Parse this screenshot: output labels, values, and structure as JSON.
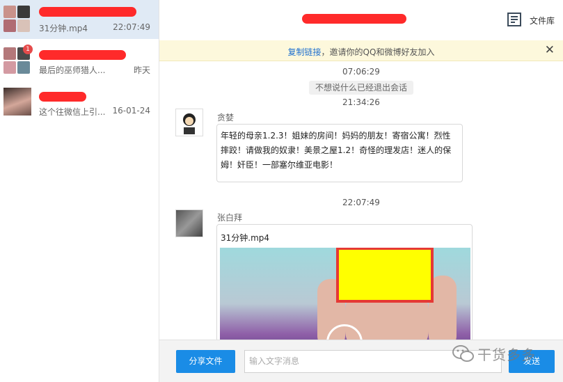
{
  "sidebar": {
    "conversations": [
      {
        "preview": "31分钟.mp4",
        "time": "22:07:49"
      },
      {
        "preview": "最后的巫师猎人...",
        "time": "昨天",
        "badge": "1"
      },
      {
        "preview": "这个往微信上引...",
        "time": "16-01-24"
      }
    ]
  },
  "header": {
    "library_label": "文件库",
    "library_icon": "file-library-icon"
  },
  "invite": {
    "link_text": "复制链接",
    "message": "，邀请你的QQ和微博好友加入",
    "close_symbol": "✕"
  },
  "chat": {
    "timestamp_1": "07:06:29",
    "system_notice": "不想说什么已经退出会话",
    "timestamp_2": "21:34:26",
    "message_1": {
      "sender": "贪婪",
      "text": "年轻的母亲1.2.3！姐妹的房间！妈妈的朋友！寄宿公寓！烈性摔跤！请做我的奴隶！美景之屋1.2！奇怪的理发店！迷人的保姆！奸臣！一部塞尔维亚电影！"
    },
    "timestamp_3": "22:07:49",
    "message_2": {
      "sender": "张白拜",
      "file_name": "31分钟.mp4"
    }
  },
  "bottom": {
    "share_label": "分享文件",
    "input_placeholder": "输入文字消息",
    "send_label": "发送"
  },
  "watermark": {
    "text": "干货多多"
  },
  "colors": {
    "accent": "#1a8ce6",
    "redaction": "#ff2a2a",
    "censor_fill": "#ffff00",
    "censor_border": "#e53935",
    "invite_bg": "#fdf8dc"
  }
}
